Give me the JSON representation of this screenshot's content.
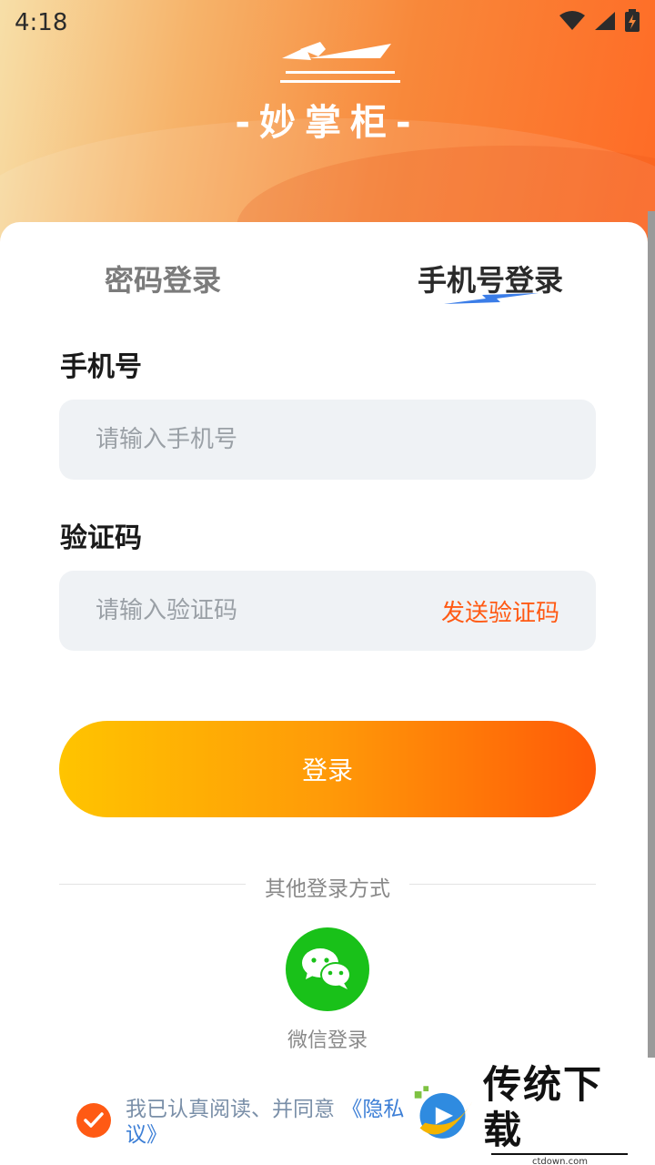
{
  "status_bar": {
    "time": "4:18",
    "icons": [
      "wifi-icon",
      "signal-icon",
      "battery-charging-icon"
    ]
  },
  "header": {
    "logo_text": "-妙掌柜-"
  },
  "tabs": [
    {
      "label": "密码登录",
      "active": false
    },
    {
      "label": "手机号登录",
      "active": true
    }
  ],
  "phone_field": {
    "label": "手机号",
    "placeholder": "请输入手机号",
    "value": ""
  },
  "code_field": {
    "label": "验证码",
    "placeholder": "请输入验证码",
    "value": "",
    "send_code_label": "发送验证码"
  },
  "login_button": {
    "label": "登录"
  },
  "other_login": {
    "divider_text": "其他登录方式",
    "wechat_label": "微信登录"
  },
  "agreement": {
    "checked": true,
    "text": "我已认真阅读、并同意",
    "link_text": "《隐私议》"
  },
  "watermark": {
    "title": "传统下载",
    "subtitle": "ctdown.com"
  },
  "colors": {
    "accent": "#ff5a14",
    "wechat_green": "#19c119",
    "input_bg": "#eff2f5",
    "button_gradient_start": "#ffc400",
    "button_gradient_end": "#ff5a08"
  }
}
